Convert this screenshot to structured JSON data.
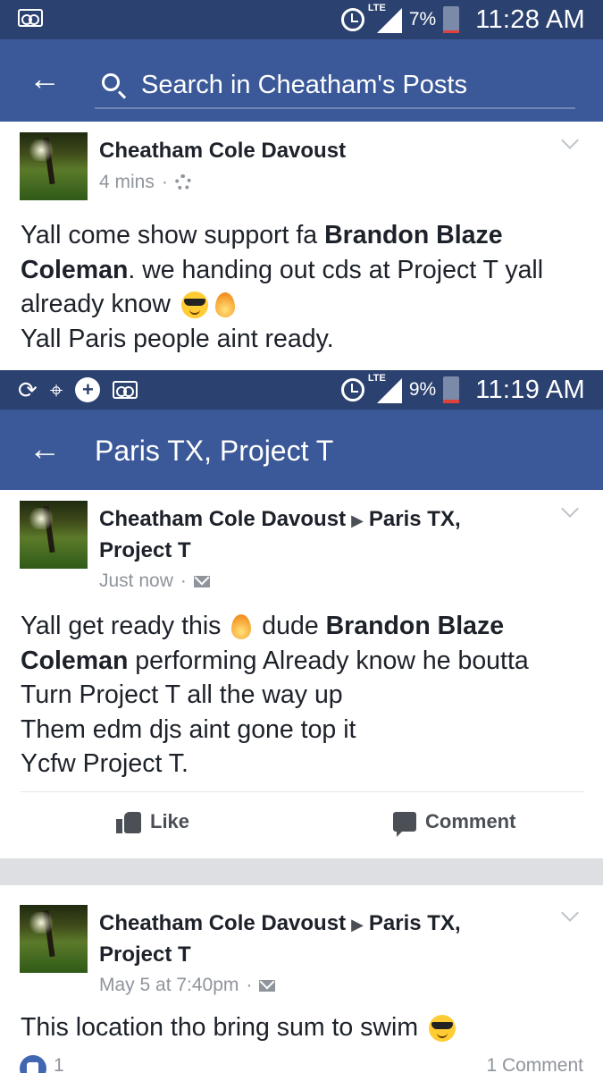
{
  "screen1": {
    "status": {
      "icons_left": [
        "voicemail-icon"
      ],
      "network": "LTE",
      "battery_pct": "7%",
      "time": "11:28 AM"
    },
    "search": {
      "placeholder": "Search in Cheatham's Posts"
    },
    "post": {
      "author": "Cheatham Cole Davoust",
      "time": "4 mins",
      "privacy_icon": "gear-icon",
      "text": {
        "p1": "Yall come show support fa ",
        "mention": "Brandon Blaze Coleman",
        "p2": ". we handing out cds at Project T yall already know ",
        "line2": "Yall Paris people aint ready."
      },
      "emojis": [
        "smiling-face-with-sunglasses",
        "fire"
      ]
    }
  },
  "screen2": {
    "status": {
      "icons_left": [
        "sync-icon",
        "location-icon",
        "plus-icon",
        "voicemail-icon"
      ],
      "network": "LTE",
      "battery_pct": "9%",
      "time": "11:19 AM"
    },
    "nav_title": "Paris TX, Project T",
    "posts": [
      {
        "author": "Cheatham Cole Davoust",
        "target": "Paris TX,",
        "target2": "Project T",
        "time": "Just now",
        "privacy_icon": "envelope-icon",
        "text": {
          "p1": "Yall get ready this ",
          "p2": " dude  ",
          "mention": "Brandon Blaze Coleman",
          "p3": " performing  Already know he boutta",
          "line2": "Turn Project T all the way up",
          "line3": "Them edm djs aint gone top it",
          "line4": "Ycfw Project T."
        },
        "actions": {
          "like": "Like",
          "comment": "Comment"
        }
      },
      {
        "author": "Cheatham Cole Davoust",
        "target": "Paris TX,",
        "target2": "Project T",
        "time": "May 5 at 7:40pm",
        "privacy_icon": "envelope-icon",
        "text": {
          "p1": "This location tho bring sum to swim "
        },
        "reactions": {
          "likes": "1",
          "comments": "1 Comment"
        }
      }
    ]
  },
  "colors": {
    "status_bg": "#2b4170",
    "nav_bg": "#3b5998",
    "text": "#1d2129",
    "meta": "#90949c",
    "separator": "#dddfe2"
  }
}
